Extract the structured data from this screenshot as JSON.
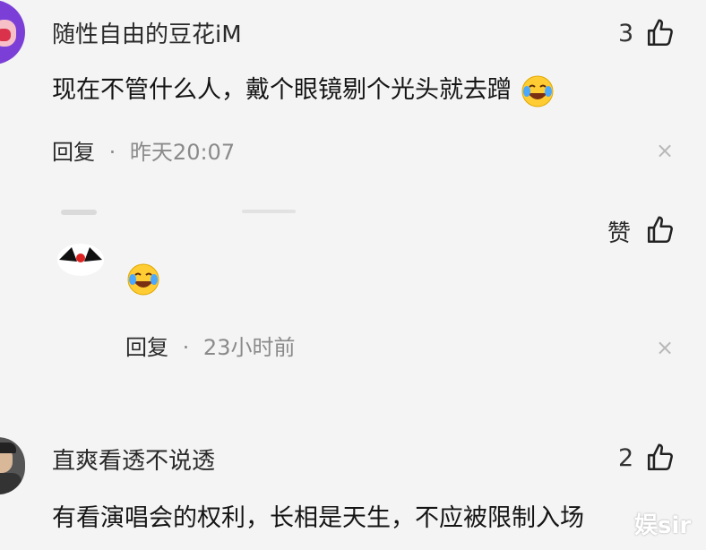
{
  "comments": [
    {
      "username": "随性自由的豆花iM",
      "text": "现在不管什么人，戴个眼镜剔个光头就去蹭",
      "reply_label": "回复",
      "separator": "·",
      "time": "昨天20:07",
      "like_count": "3",
      "close_symbol": "×"
    },
    {
      "reply": {
        "like_label": "赞",
        "reply_label": "回复",
        "separator": "·",
        "time": "23小时前",
        "close_symbol": "×"
      }
    },
    {
      "username": "直爽看透不说透",
      "text": "有看演唱会的权利，长相是天生，不应被限制入场",
      "like_count": "2"
    }
  ],
  "watermark": "娱sir",
  "colors": {
    "background": "#f4f4f4",
    "meta": "#8a8a8a",
    "text": "#151515"
  }
}
